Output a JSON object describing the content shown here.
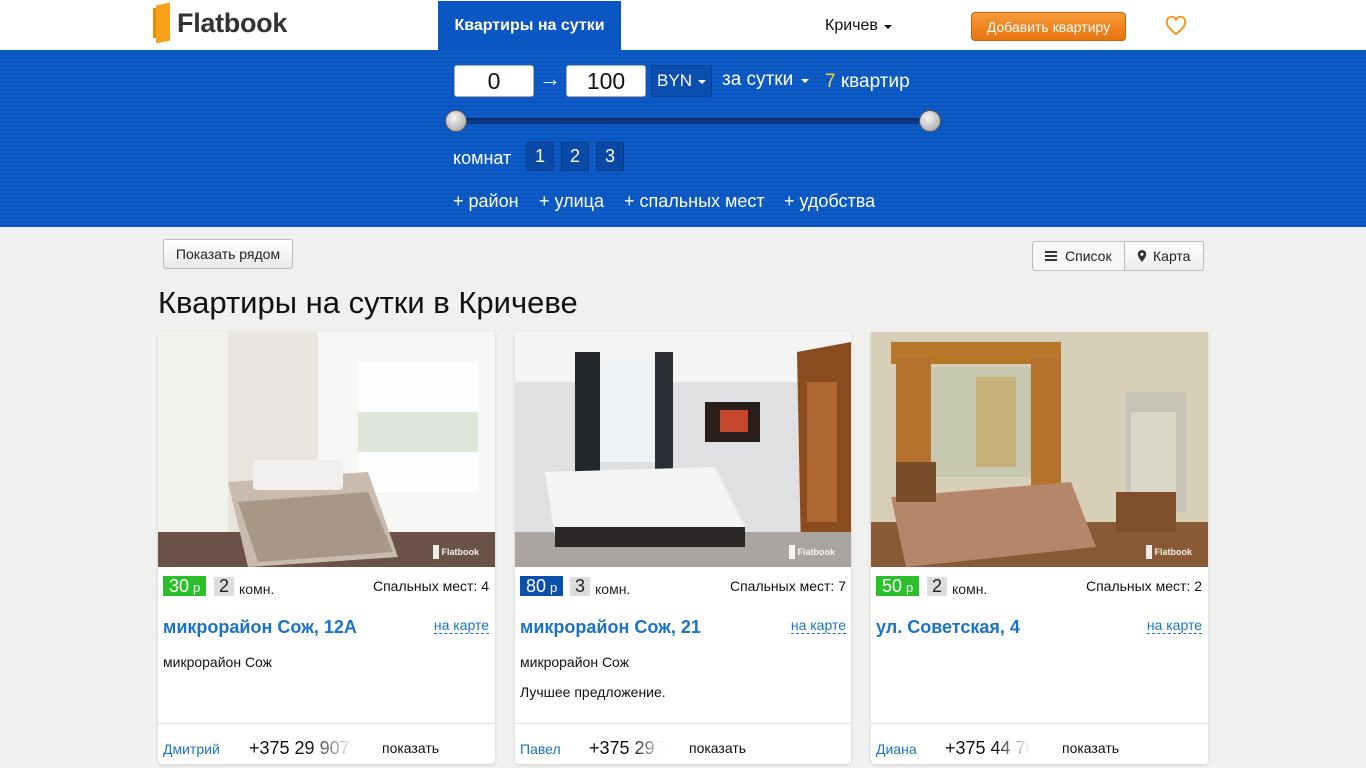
{
  "nav": {
    "logo": "Flatbook",
    "active_tab": "Квартиры на сутки",
    "city": "Кричев",
    "add_button": "Добавить квартиру"
  },
  "filter": {
    "price_min": "0",
    "price_max": "100",
    "arrow": "→",
    "currency": "BYN",
    "period": "за сутки",
    "count": "7",
    "count_unit": "квартир",
    "rooms_label": "комнат",
    "rooms": [
      "1",
      "2",
      "3"
    ],
    "extras": [
      "+ район",
      "+ улица",
      "+ спальных мест",
      "+ удобства"
    ]
  },
  "toolbar": {
    "near_button": "Показать рядом",
    "list_button": "Список",
    "map_button": "Карта"
  },
  "page_title": "Квартиры на сутки в Кричеве",
  "listings": [
    {
      "price": "30",
      "price_unit": "р",
      "price_color": "#2bc02b",
      "rooms": "2",
      "rooms_unit": "комн.",
      "beds": "Спальных мест: 4",
      "address": "микрорайон Сож, 12А",
      "map_link": "на карте",
      "district": "микрорайон Сож",
      "description": "",
      "owner": "Дмитрий",
      "phone": "+375 29 907",
      "show": "показать",
      "watermark": "Flatbook"
    },
    {
      "price": "80",
      "price_unit": "р",
      "price_color": "#0a4fa8",
      "rooms": "3",
      "rooms_unit": "комн.",
      "beds": "Спальных мест: 7",
      "address": "микрорайон Сож, 21",
      "map_link": "на карте",
      "district": "микрорайон Сож",
      "description": "Лучшее предложение.",
      "owner": "Павел",
      "phone": "+375 29 7",
      "show": "показать",
      "watermark": "Flatbook"
    },
    {
      "price": "50",
      "price_unit": "р",
      "price_color": "#2bc02b",
      "rooms": "2",
      "rooms_unit": "комн.",
      "beds": "Спальных мест: 2",
      "address": "ул. Советская, 4",
      "map_link": "на карте",
      "district": "",
      "description": "",
      "owner": "Диана",
      "phone": "+375 44 70",
      "show": "показать",
      "watermark": "Flatbook"
    }
  ]
}
